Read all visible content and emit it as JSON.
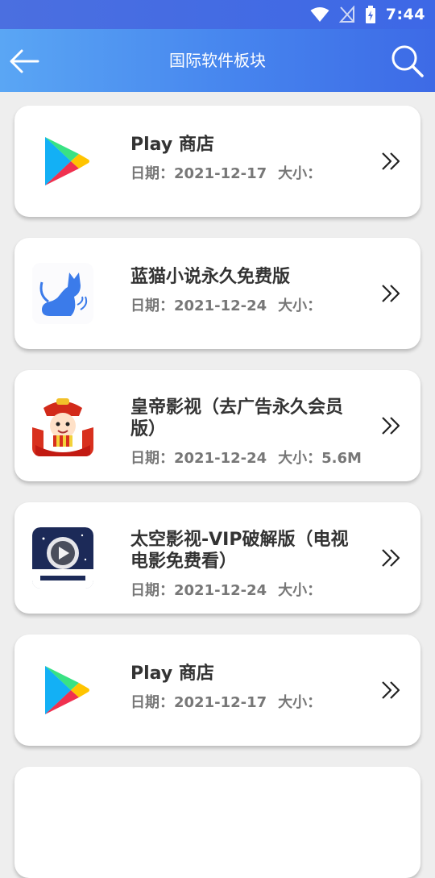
{
  "status": {
    "time": "7:44"
  },
  "appbar": {
    "title": "国际软件板块"
  },
  "items": [
    {
      "name": "Play 商店",
      "date_label": "日期：",
      "date": "2021-12-17",
      "size_label": "大小：",
      "size": "",
      "icon": "play-store-icon"
    },
    {
      "name": "蓝猫小说永久免费版",
      "date_label": "日期：",
      "date": "2021-12-24",
      "size_label": "大小：",
      "size": "",
      "icon": "blue-cat-icon"
    },
    {
      "name": "皇帝影视（去广告永久会员版）",
      "date_label": "日期：",
      "date": "2021-12-24",
      "size_label": "大小：",
      "size": "5.6M",
      "icon": "emperor-video-icon"
    },
    {
      "name": "太空影视-VIP破解版（电视电影免费看）",
      "date_label": "日期：",
      "date": "2021-12-24",
      "size_label": "大小：",
      "size": "",
      "icon": "space-video-icon"
    },
    {
      "name": "Play 商店",
      "date_label": "日期：",
      "date": "2021-12-17",
      "size_label": "大小：",
      "size": "",
      "icon": "play-store-icon"
    }
  ],
  "colors": {
    "appbar_start": "#5aa6f4",
    "appbar_end": "#3d6ae6",
    "background": "#eeeeee"
  }
}
